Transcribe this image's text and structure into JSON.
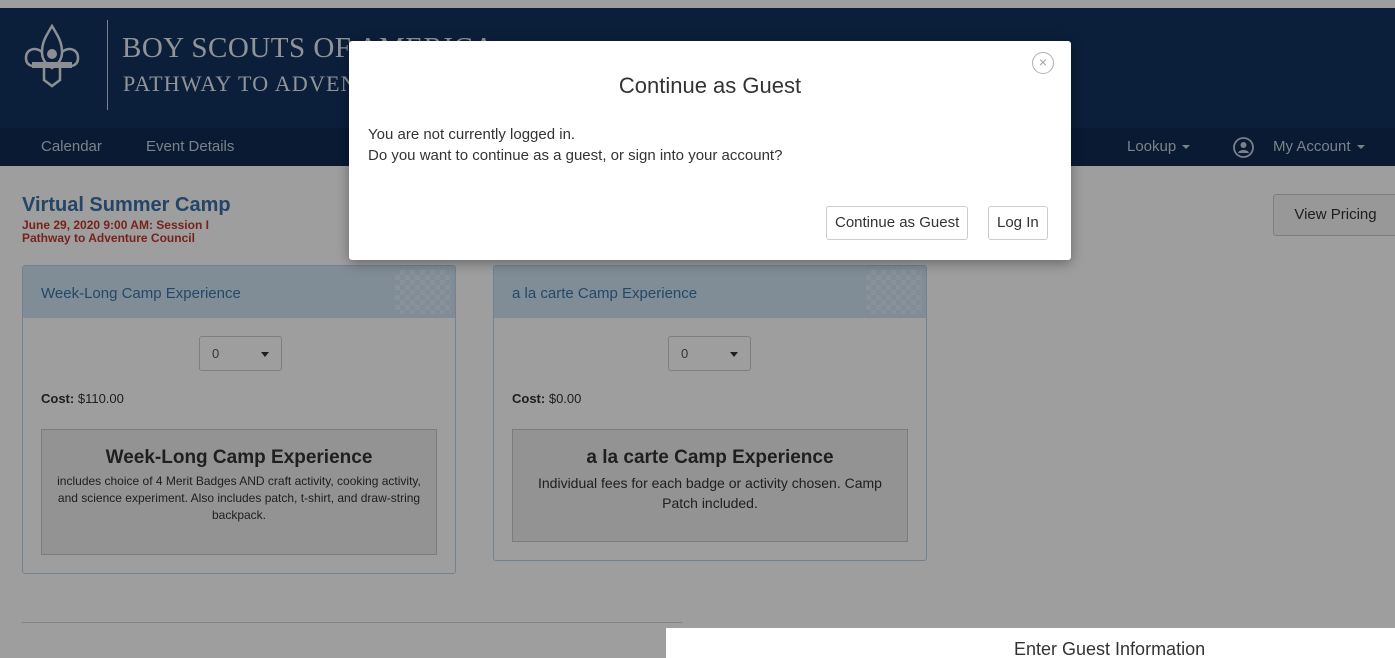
{
  "brand": {
    "line1": "BOY SCOUTS OF AMERICA",
    "line2": "PATHWAY TO ADVENTURE"
  },
  "nav": {
    "calendar": "Calendar",
    "event_details": "Event Details",
    "lookup": "Lookup",
    "my_account": "My Account"
  },
  "event": {
    "title": "Virtual Summer Camp",
    "date_session": "June 29, 2020 9:00 AM: Session I",
    "council": "Pathway to Adventure Council",
    "view_pricing": "View Pricing"
  },
  "cards": [
    {
      "header": "Week-Long Camp Experience",
      "quantity": "0",
      "cost_label": "Cost:",
      "cost_value": "$110.00",
      "desc_title": "Week-Long Camp Experience",
      "desc_text": "includes choice of 4 Merit Badges AND craft activity, cooking activity, and science experiment. Also includes patch, t-shirt, and draw-string backpack."
    },
    {
      "header": "a la carte Camp Experience",
      "quantity": "0",
      "cost_label": "Cost:",
      "cost_value": "$0.00",
      "desc_title": "a la carte Camp Experience",
      "desc_text": "Individual fees for each badge or activity chosen. Camp Patch included."
    }
  ],
  "guest_panel": {
    "title": "Enter Guest Information"
  },
  "modal": {
    "title": "Continue as Guest",
    "close": "×",
    "line1": "You are not currently logged in.",
    "line2": "Do you want to continue as a guest, or sign into your account?",
    "continue_button": "Continue as Guest",
    "login_button": "Log In"
  }
}
